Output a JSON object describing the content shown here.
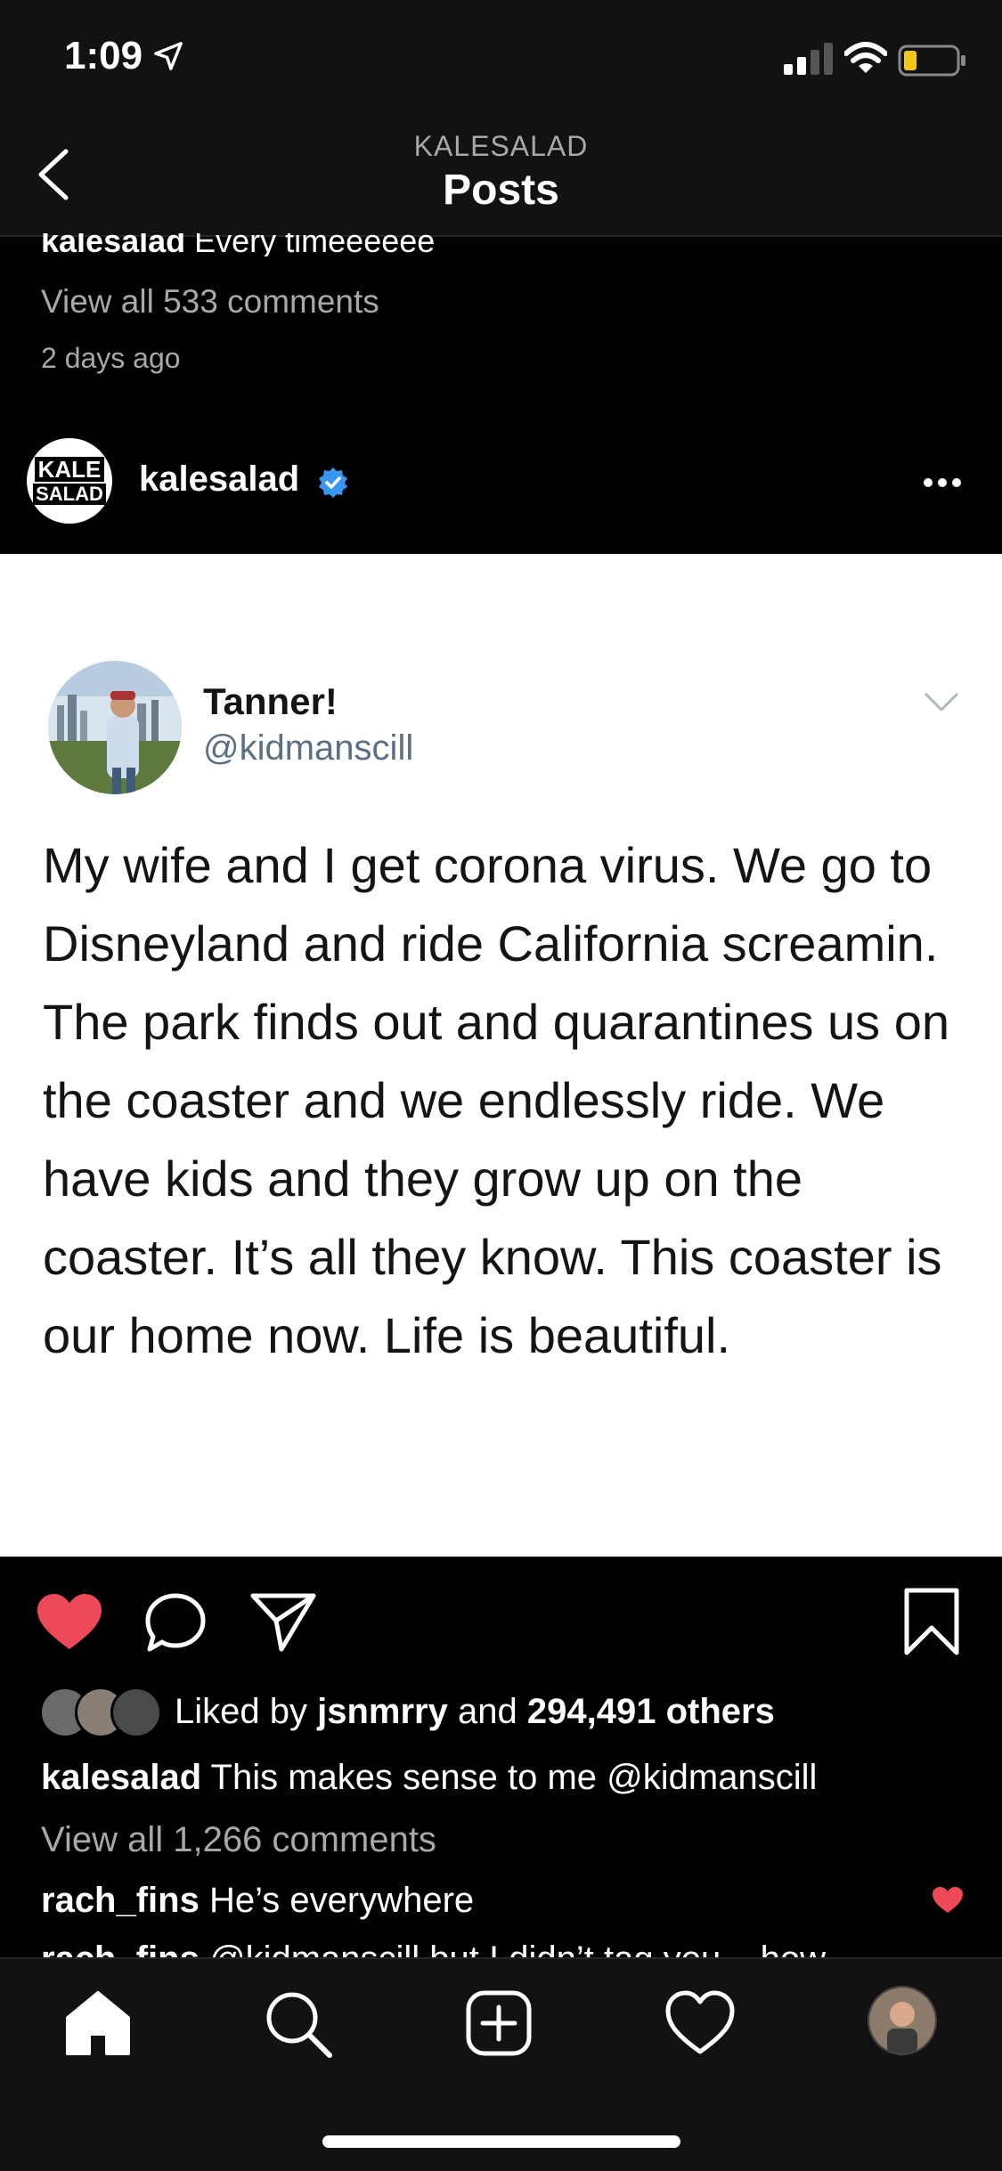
{
  "status_bar": {
    "time": "1:09"
  },
  "header": {
    "subtitle": "KALESALAD",
    "title": "Posts"
  },
  "previous_post": {
    "caption_user": "kalesalad",
    "caption_text": "Every timeeeeee",
    "view_all_comments": "View all 533 comments",
    "timestamp": "2 days ago"
  },
  "post": {
    "username": "kalesalad",
    "avatar_text_top": "KALE",
    "avatar_text_bottom": "SALAD",
    "tweet": {
      "name": "Tanner!",
      "handle": "@kidmanscill",
      "text": "My wife and I get corona virus. We go to Disneyland and ride California screamin. The park finds out and quarantines us on the coaster and we endlessly ride. We have kids and they grow up on the coaster. It’s all they know. This coaster is our home now. Life is beautiful."
    },
    "likes": {
      "prefix": "Liked by",
      "user": "jsnmrry",
      "and": "and",
      "count": "294,491 others"
    },
    "caption": {
      "user": "kalesalad",
      "text": "This makes sense to me @kidmanscill"
    },
    "view_all_comments": "View all 1,266 comments",
    "comments": [
      {
        "user": "rach_fins",
        "text": "He’s everywhere"
      },
      {
        "user": "rach_fins",
        "text": "@kidmanscill but I didn’t tag you... how"
      }
    ]
  },
  "colors": {
    "background": "#000000",
    "bar": "#121212",
    "like_red": "#ed4956",
    "verified_blue": "#3897f0",
    "muted": "#a8a8a8"
  },
  "icons": [
    "back-icon",
    "verified-icon",
    "more-icon",
    "heart-icon",
    "comment-icon",
    "share-icon",
    "bookmark-icon",
    "home-icon",
    "search-icon",
    "new-post-icon",
    "activity-icon"
  ]
}
